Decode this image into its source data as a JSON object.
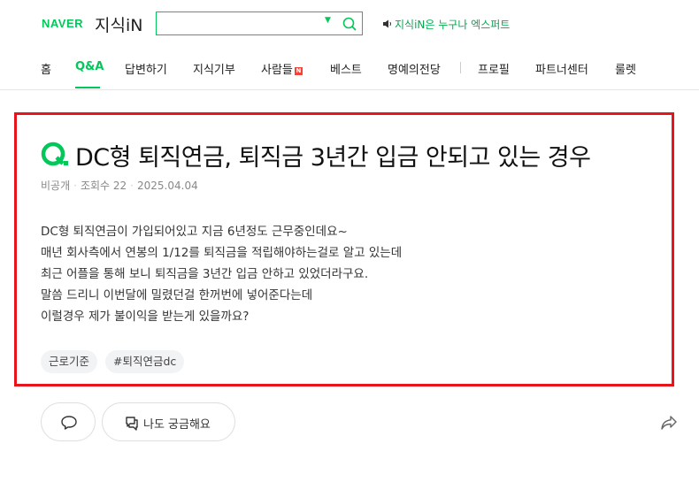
{
  "header": {
    "naver_logo": "NAVER",
    "kin_logo": "지식iN",
    "search": {
      "value": "",
      "placeholder": ""
    },
    "promo_text": "지식iN은 누구나 엑스퍼트",
    "brand_color": "#03c75a"
  },
  "nav": {
    "items": [
      {
        "label": "홈"
      },
      {
        "label": "Q&A",
        "active": true
      },
      {
        "label": "답변하기"
      },
      {
        "label": "지식기부"
      },
      {
        "label": "사람들",
        "badge": "N"
      },
      {
        "label": "베스트"
      },
      {
        "label": "명예의전당"
      },
      {
        "label": "프로필"
      },
      {
        "label": "파트너센터"
      },
      {
        "label": "룰렛"
      }
    ]
  },
  "question": {
    "q_mark": "Q.",
    "title": "DC형 퇴직연금, 퇴직금 3년간 입금 안되고 있는 경우",
    "author": "비공개",
    "views": "조회수 22",
    "date": "2025.04.04",
    "body": [
      "DC형 퇴직연금이 가입되어있고 지금 6년정도 근무중인데요~",
      "매년 회사측에서 연봉의 1/12를 퇴직금을 적립해야하는걸로 알고 있는데",
      "최근 어플을 통해 보니 퇴직금을 3년간 입금 안하고 있었더라구요.",
      "말씀 드리니 이번달에 밀렸던걸 한꺼번에 넣어준다는데",
      "이럴경우 제가 불이익을 받는게 있을까요?"
    ],
    "tags": [
      "근로기준",
      "#퇴직연금dc"
    ]
  },
  "actions": {
    "curious_label": "나도 궁금해요",
    "comment_icon": "speech-bubble-icon",
    "curious_icon": "question-bubble-icon",
    "share_icon": "share-arrow-icon"
  },
  "highlight_color": "#e8141b"
}
